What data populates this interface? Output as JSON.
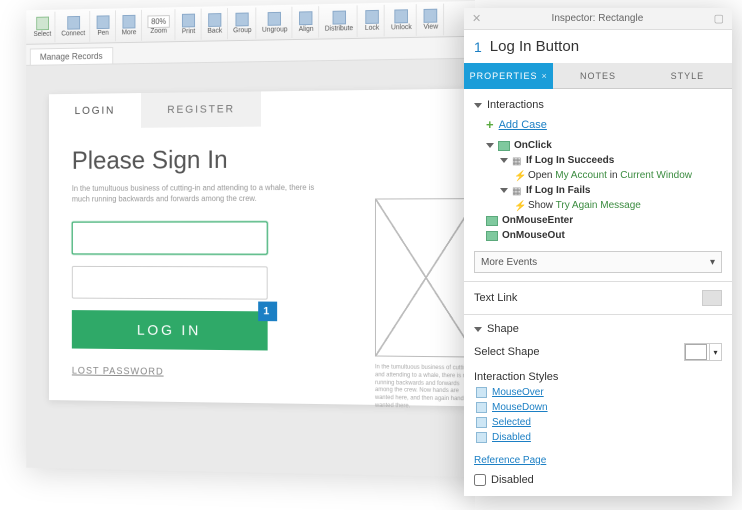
{
  "toolbar": {
    "buttons": [
      "Select",
      "Connect",
      "Pen",
      "More",
      "Zoom",
      "Print",
      "Back",
      "Group",
      "Ungroup",
      "Align",
      "Distribute",
      "Lock",
      "Unlock",
      "View"
    ],
    "zoom_value": "80%"
  },
  "file_tab": "Manage Records",
  "form": {
    "tabs": {
      "login": "LOGIN",
      "register": "REGISTER"
    },
    "heading": "Please Sign In",
    "sub": "In the tumultuous business of cutting-in and attending to a whale, there is much running backwards and forwards among the crew.",
    "button": "LOG IN",
    "badge": "1",
    "lost": "LOST PASSWORD",
    "wireframe_caption": "In the tumultuous business of cutting-in and attending to a whale, there is much running backwards and forwards among the crew. Now hands are wanted here, and then again hands are wanted there."
  },
  "inspector": {
    "title": "Inspector: Rectangle",
    "index": "1",
    "name": "Log In Button",
    "tabs": {
      "properties": "PROPERTIES",
      "notes": "NOTES",
      "style": "STYLE"
    },
    "interactions": {
      "label": "Interactions",
      "add_case": "Add Case",
      "tree": {
        "onclick": "OnClick",
        "if_succeeds": "If Log In Succeeds",
        "open_pre": "Open ",
        "open_link": "My Account",
        "open_mid": " in ",
        "open_win": "Current Window",
        "if_fails": "If Log In Fails",
        "show_pre": "Show ",
        "show_link": "Try Again Message",
        "onmouseenter": "OnMouseEnter",
        "onmouseout": "OnMouseOut"
      },
      "more_events": "More Events"
    },
    "text_link": "Text Link",
    "shape": {
      "label": "Shape",
      "select": "Select Shape"
    },
    "interaction_styles": {
      "label": "Interaction Styles",
      "items": [
        "MouseOver",
        "MouseDown",
        "Selected",
        "Disabled"
      ]
    },
    "reference_page": "Reference Page",
    "disabled": "Disabled"
  }
}
